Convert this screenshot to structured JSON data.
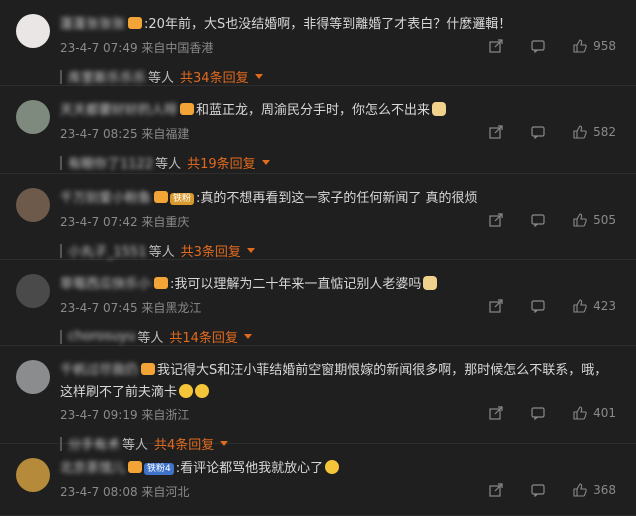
{
  "comments": [
    {
      "name": "蓬蓬张张张张",
      "text": ":20年前，大S也没结婚啊，非得等到離婚了才表白？什麼邏輯！",
      "meta": "23-4-7 07:49 来自中国香港",
      "likes": "958",
      "reply_name": "库里斯乐小小",
      "reply_suffix": "等人",
      "reply_count": "共三十四条回复",
      "avatar_color": "#e7dede"
    }
  ]
}
